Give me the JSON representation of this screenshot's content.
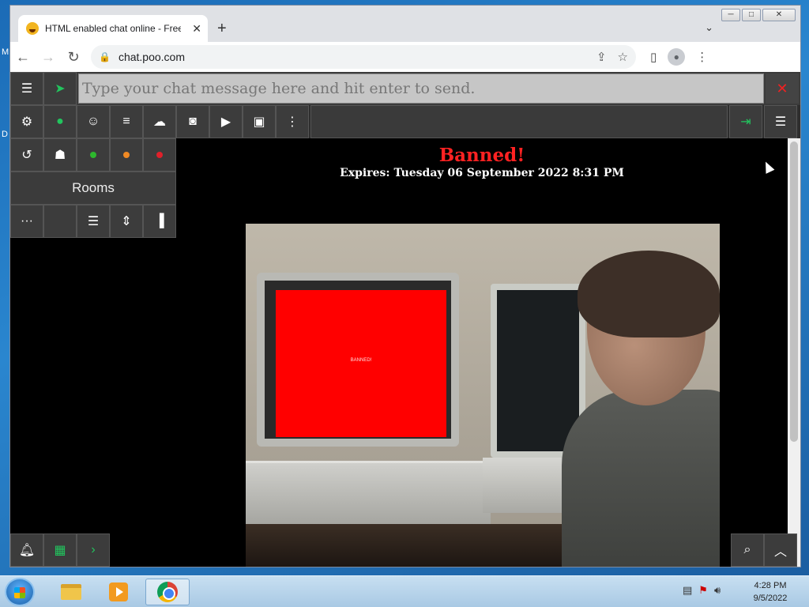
{
  "desktop": {
    "letters": [
      "M",
      "D"
    ]
  },
  "browser": {
    "tab_title": "HTML enabled chat online - Free",
    "tab_close": "✕",
    "new_tab": "+",
    "tab_dropdown": "⌄",
    "url": "chat.poo.com",
    "caption": {
      "minimize": "─",
      "maximize": "□",
      "close": "✕"
    }
  },
  "chat": {
    "input_placeholder": "Type your chat message here and hit enter to send.",
    "rooms_label": "Rooms",
    "banned_title": "Banned!",
    "expires_text": "Expires: Tuesday 06 September 2022 8:31 PM",
    "screen_text": "BANNED!"
  },
  "colors": {
    "accent_green": "#22c55e",
    "banned_red": "#ff2222",
    "dot_green": "#2db82d",
    "dot_orange": "#f08a24",
    "dot_red": "#e0202a"
  },
  "taskbar": {
    "time": "4:28 PM",
    "date": "9/5/2022"
  }
}
